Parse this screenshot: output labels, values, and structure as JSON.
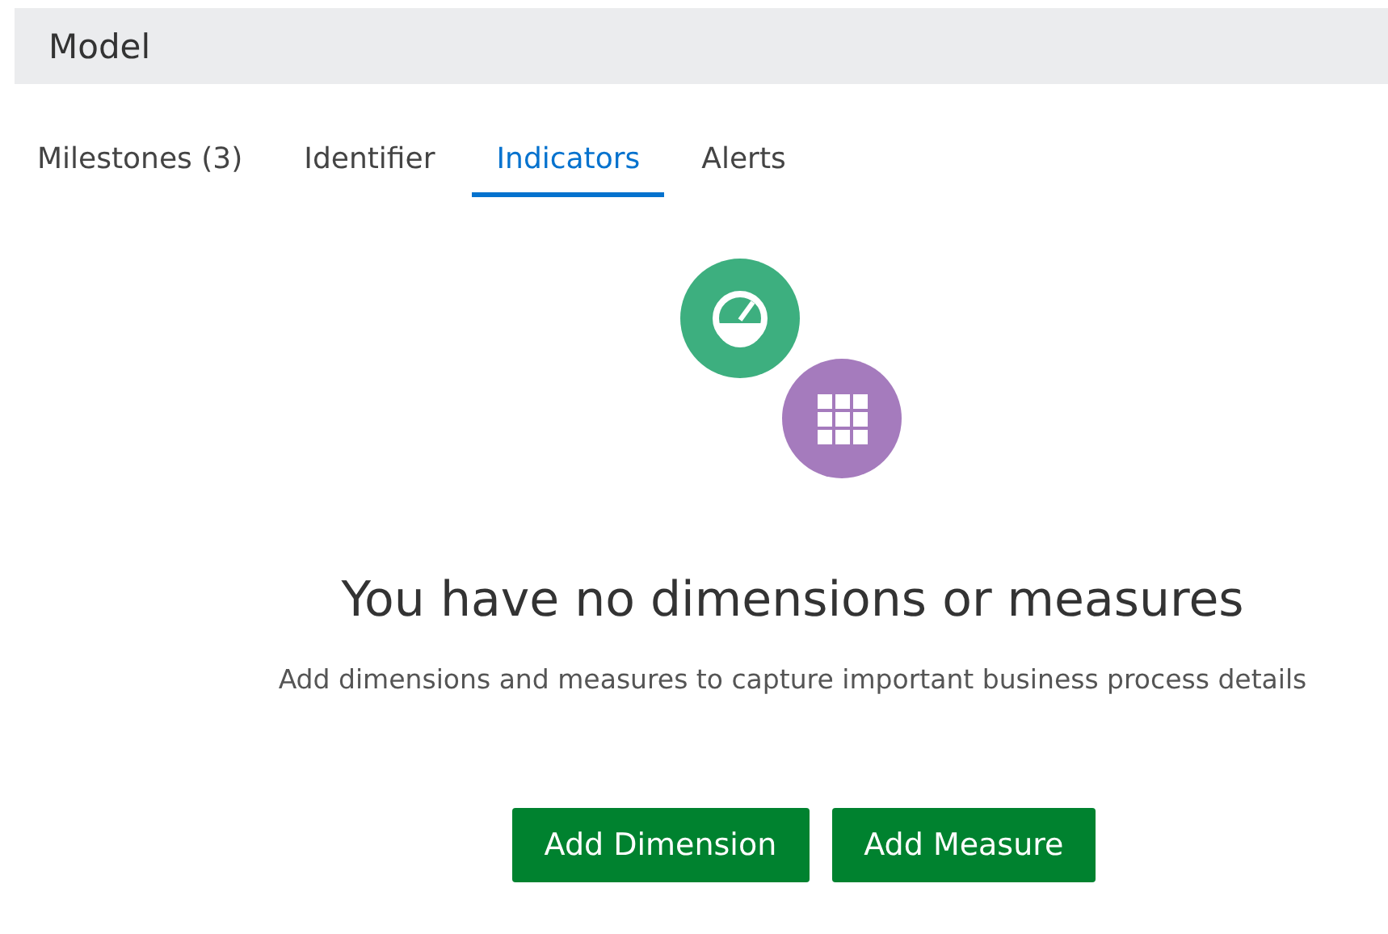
{
  "header": {
    "title": "Model"
  },
  "tabs": [
    {
      "label": "Milestones (3)",
      "selected": false
    },
    {
      "label": "Identifier",
      "selected": false
    },
    {
      "label": "Indicators",
      "selected": true
    },
    {
      "label": "Alerts",
      "selected": false
    }
  ],
  "empty_state": {
    "heading": "You have no dimensions or measures",
    "message": "Add dimensions and measures to capture important business process details"
  },
  "buttons": [
    {
      "label": "Add Dimension"
    },
    {
      "label": "Add Measure"
    }
  ]
}
